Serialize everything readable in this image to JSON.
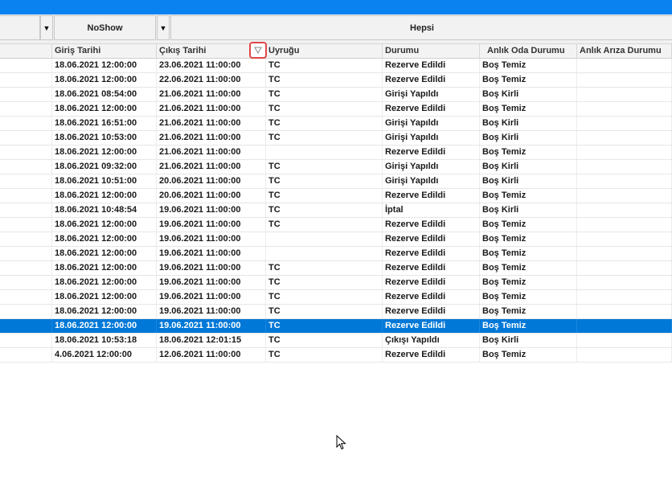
{
  "filters": {
    "noshow_label": "NoShow",
    "hepsi_label": "Hepsi",
    "dropdown_arrow": "▼"
  },
  "headers": {
    "giris": "Giriş Tarihi",
    "cikis": "Çıkış Tarihi",
    "uyrugu": "Uyruğu",
    "durumu": "Durumu",
    "oda": "Anlık Oda Durumu",
    "ariza": "Anlık Arıza Durumu"
  },
  "sort_icon": "filter-icon",
  "rows": [
    {
      "giris": "18.06.2021 12:00:00",
      "cikis": "23.06.2021 11:00:00",
      "uyrugu": "TC",
      "durumu": "Rezerve Edildi",
      "oda": "Boş Temiz"
    },
    {
      "giris": "18.06.2021 12:00:00",
      "cikis": "22.06.2021 11:00:00",
      "uyrugu": "TC",
      "durumu": "Rezerve Edildi",
      "oda": "Boş Temiz"
    },
    {
      "giris": "18.06.2021 08:54:00",
      "cikis": "21.06.2021 11:00:00",
      "uyrugu": "TC",
      "durumu": "Girişi Yapıldı",
      "oda": "Boş Kirli"
    },
    {
      "giris": "18.06.2021 12:00:00",
      "cikis": "21.06.2021 11:00:00",
      "uyrugu": "TC",
      "durumu": "Rezerve Edildi",
      "oda": "Boş Temiz"
    },
    {
      "giris": "18.06.2021 16:51:00",
      "cikis": "21.06.2021 11:00:00",
      "uyrugu": "TC",
      "durumu": "Girişi Yapıldı",
      "oda": "Boş Kirli"
    },
    {
      "giris": "18.06.2021 10:53:00",
      "cikis": "21.06.2021 11:00:00",
      "uyrugu": "TC",
      "durumu": "Girişi Yapıldı",
      "oda": "Boş Kirli"
    },
    {
      "giris": "18.06.2021 12:00:00",
      "cikis": "21.06.2021 11:00:00",
      "uyrugu": "",
      "durumu": "Rezerve Edildi",
      "oda": "Boş Temiz"
    },
    {
      "giris": "18.06.2021 09:32:00",
      "cikis": "21.06.2021 11:00:00",
      "uyrugu": "TC",
      "durumu": "Girişi Yapıldı",
      "oda": "Boş Kirli"
    },
    {
      "giris": "18.06.2021 10:51:00",
      "cikis": "20.06.2021 11:00:00",
      "uyrugu": "TC",
      "durumu": "Girişi Yapıldı",
      "oda": "Boş Kirli"
    },
    {
      "giris": "18.06.2021 12:00:00",
      "cikis": "20.06.2021 11:00:00",
      "uyrugu": "TC",
      "durumu": "Rezerve Edildi",
      "oda": "Boş Temiz"
    },
    {
      "giris": "18.06.2021 10:48:54",
      "cikis": "19.06.2021 11:00:00",
      "uyrugu": "TC",
      "durumu": "İptal",
      "oda": "Boş Kirli"
    },
    {
      "giris": "18.06.2021 12:00:00",
      "cikis": "19.06.2021 11:00:00",
      "uyrugu": "TC",
      "durumu": "Rezerve Edildi",
      "oda": "Boş Temiz"
    },
    {
      "giris": "18.06.2021 12:00:00",
      "cikis": "19.06.2021 11:00:00",
      "uyrugu": "",
      "durumu": "Rezerve Edildi",
      "oda": "Boş Temiz"
    },
    {
      "giris": "18.06.2021 12:00:00",
      "cikis": "19.06.2021 11:00:00",
      "uyrugu": "",
      "durumu": "Rezerve Edildi",
      "oda": "Boş Temiz"
    },
    {
      "giris": "18.06.2021 12:00:00",
      "cikis": "19.06.2021 11:00:00",
      "uyrugu": "TC",
      "durumu": "Rezerve Edildi",
      "oda": "Boş Temiz"
    },
    {
      "giris": "18.06.2021 12:00:00",
      "cikis": "19.06.2021 11:00:00",
      "uyrugu": "TC",
      "durumu": "Rezerve Edildi",
      "oda": "Boş Temiz"
    },
    {
      "giris": "18.06.2021 12:00:00",
      "cikis": "19.06.2021 11:00:00",
      "uyrugu": "TC",
      "durumu": "Rezerve Edildi",
      "oda": "Boş Temiz"
    },
    {
      "giris": "18.06.2021 12:00:00",
      "cikis": "19.06.2021 11:00:00",
      "uyrugu": "TC",
      "durumu": "Rezerve Edildi",
      "oda": "Boş Temiz"
    },
    {
      "giris": "18.06.2021 12:00:00",
      "cikis": "19.06.2021 11:00:00",
      "uyrugu": "TC",
      "durumu": "Rezerve Edildi",
      "oda": "Boş Temiz",
      "selected": true
    },
    {
      "giris": "18.06.2021 10:53:18",
      "cikis": "18.06.2021 12:01:15",
      "uyrugu": "TC",
      "durumu": "Çıkışı Yapıldı",
      "oda": "Boş Kirli"
    },
    {
      "giris": "4.06.2021 12:00:00",
      "cikis": "12.06.2021 11:00:00",
      "uyrugu": "TC",
      "durumu": "Rezerve Edildi",
      "oda": "Boş Temiz"
    }
  ]
}
